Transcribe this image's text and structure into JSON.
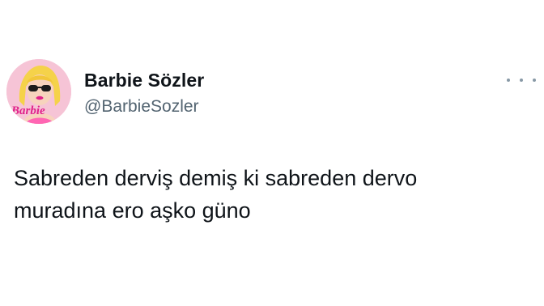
{
  "author": {
    "display_name": "Barbie Sözler",
    "handle": "@BarbieSozler",
    "avatar_logo_text": "Barbie"
  },
  "tweet": {
    "text_lines": [
      "Sabreden derviş demiş ki sabreden dervo",
      "muradına ero aşko güno"
    ]
  },
  "icons": {
    "more": "more-options-icon"
  },
  "colors": {
    "name": "#0f1419",
    "handle": "#536471",
    "avatar_bg": "#f6c4d6",
    "avatar_logo": "#e0218a"
  }
}
